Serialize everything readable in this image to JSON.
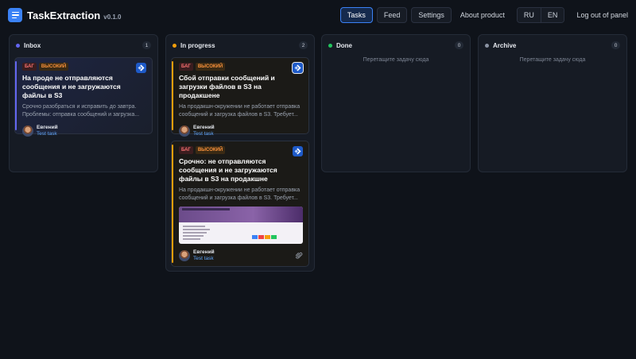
{
  "header": {
    "brand": "TaskExtraction",
    "version": "v0.1.0",
    "logo_icon": "document-lines-icon",
    "nav": {
      "tasks": "Tasks",
      "feed": "Feed",
      "settings": "Settings",
      "about": "About product"
    },
    "active_tab": "Tasks",
    "lang": {
      "ru": "RU",
      "en": "EN"
    },
    "logout": "Log out of panel",
    "accent": "#3b82f6"
  },
  "columns": [
    {
      "title": "Inbox",
      "count": "1",
      "dot_color": "#6366f1"
    },
    {
      "title": "In progress",
      "count": "2",
      "dot_color": "#f59e0b"
    },
    {
      "title": "Done",
      "count": "0",
      "dot_color": "#22c55e",
      "drop_hint": "Перетащите задачу сюда"
    },
    {
      "title": "Archive",
      "count": "0",
      "dot_color": "#8b93a3",
      "drop_hint": "Перетащите задачу сюда"
    }
  ],
  "cards": {
    "inbox_1": {
      "tag_type": "БАГ",
      "tag_priority": "ВЫСОКИЙ",
      "title": "На проде не отправляются сообщения и не загружаются файлы в S3",
      "desc": "Срочно разобраться и исправить до завтра. Проблемы: отправка сообщений и загрузка...",
      "user": "Евгений",
      "link": "Test task",
      "icon": "jira-icon"
    },
    "prog_1": {
      "tag_type": "БАГ",
      "tag_priority": "ВЫСОКИЙ",
      "title": "Сбой отправки сообщений и загрузки файлов в S3 на продакшене",
      "desc": "На продакшн-окружении не работает отправка сообщений и загрузка файлов в S3. Требует...",
      "user": "Евгений",
      "link": "Test task",
      "icon": "jira-icon"
    },
    "prog_2": {
      "tag_type": "БАГ",
      "tag_priority": "ВЫСОКИЙ",
      "title": "Срочно: не отправляются сообщения и не загружаются файлы в S3 на продакшне",
      "desc": "На продакшн-окружении не работает отправка сообщений и загрузка файлов в S3. Требует...",
      "user": "Евгений",
      "link": "Test task",
      "icon": "jira-icon",
      "attachment_icon": "paperclip-icon"
    }
  }
}
